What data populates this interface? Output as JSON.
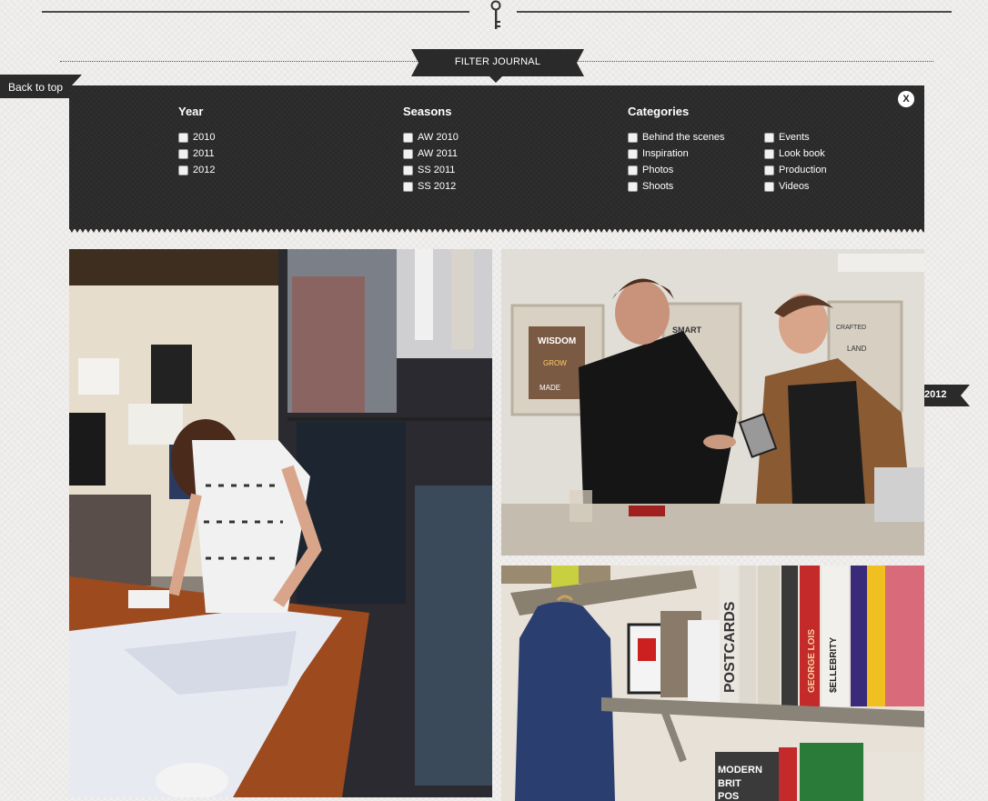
{
  "nav": {
    "filter_label": "FILTER JOURNAL",
    "back_to_top": "Back to top"
  },
  "filter": {
    "close_label": "X",
    "year": {
      "title": "Year",
      "options": [
        "2010",
        "2011",
        "2012"
      ]
    },
    "seasons": {
      "title": "Seasons",
      "options": [
        "AW 2010",
        "AW 2011",
        "SS 2011",
        "SS 2012"
      ]
    },
    "categories": {
      "title": "Categories",
      "left": [
        "Behind the scenes",
        "Inspiration",
        "Photos",
        "Shoots"
      ],
      "right": [
        "Events",
        "Look book",
        "Production",
        "Videos"
      ]
    }
  },
  "post": {
    "date_tag": "2012"
  },
  "photos": {
    "left": {
      "subject": "Woman folding garments at a workshop table"
    },
    "top_right": {
      "subject": "Two men holding a card reader in a gallery"
    },
    "bottom_right": {
      "subject": "Blue shirt on a hanger next to a bookshelf"
    },
    "posters": [
      "WISDOM",
      "SMART",
      "CRAFTED",
      "GROW",
      "MADE",
      "LAND"
    ],
    "book_spines": [
      "POSTCARDS",
      "$ELLEBRITY",
      "GEORGE LOIS",
      "MODERN",
      "BRIT",
      "POS"
    ]
  },
  "colors": {
    "panel": "#2c2c2c",
    "ribbon": "#2a2a2a",
    "page_bg": "#f1f0ee"
  }
}
